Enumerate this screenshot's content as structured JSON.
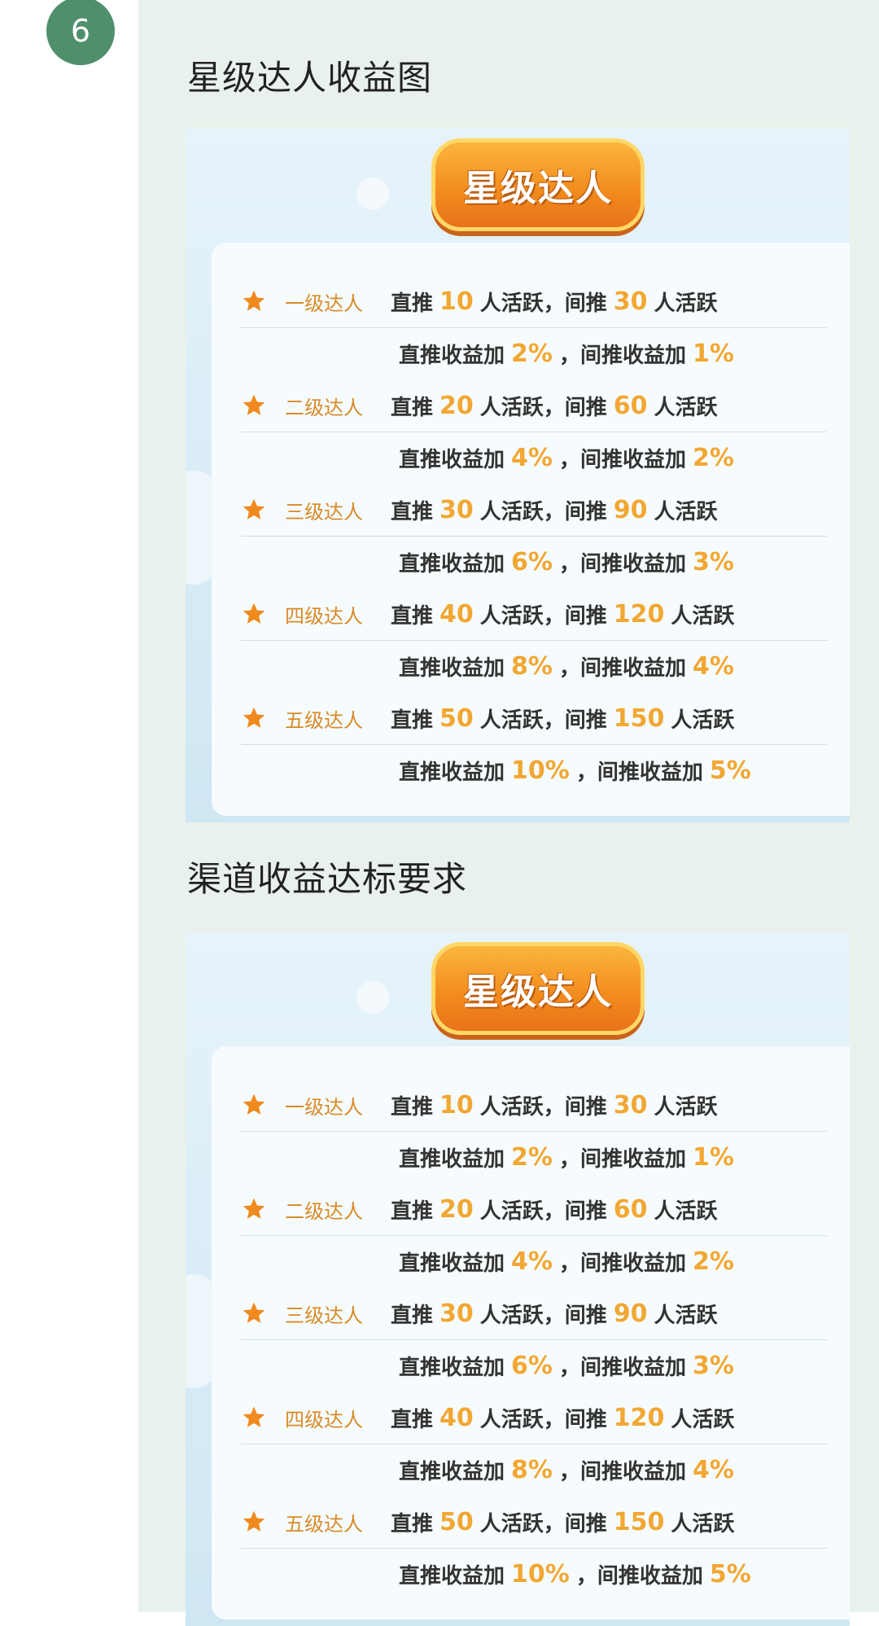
{
  "step": {
    "number": "6"
  },
  "sections": [
    {
      "heading": "星级达人收益图"
    },
    {
      "heading": "渠道收益达标要求"
    }
  ],
  "banner": {
    "title": "星级达人"
  },
  "labels": {
    "direct": "直推",
    "indirect": "间推",
    "active_suffix": "人活跃，",
    "active_end": "人活跃",
    "direct_bonus": "直推收益加",
    "indirect_bonus": "间推收益加",
    "comma": "，"
  },
  "tiers": [
    {
      "name": "一级达人",
      "direct_count": "10",
      "indirect_count": "30",
      "direct_bonus": "2%",
      "indirect_bonus": "1%"
    },
    {
      "name": "二级达人",
      "direct_count": "20",
      "indirect_count": "60",
      "direct_bonus": "4%",
      "indirect_bonus": "2%"
    },
    {
      "name": "三级达人",
      "direct_count": "30",
      "indirect_count": "90",
      "direct_bonus": "6%",
      "indirect_bonus": "3%"
    },
    {
      "name": "四级达人",
      "direct_count": "40",
      "indirect_count": "120",
      "direct_bonus": "8%",
      "indirect_bonus": "4%"
    },
    {
      "name": "五级达人",
      "direct_count": "50",
      "indirect_count": "150",
      "direct_bonus": "10%",
      "indirect_bonus": "5%"
    }
  ],
  "colors": {
    "badge": "#4f8f6c",
    "accent_number": "#f2a733",
    "tier_name": "#d98a28",
    "star": "#f08a1e",
    "panel_bg": "#e9f1ec"
  },
  "icons": {
    "tier_marker": "star-icon"
  }
}
